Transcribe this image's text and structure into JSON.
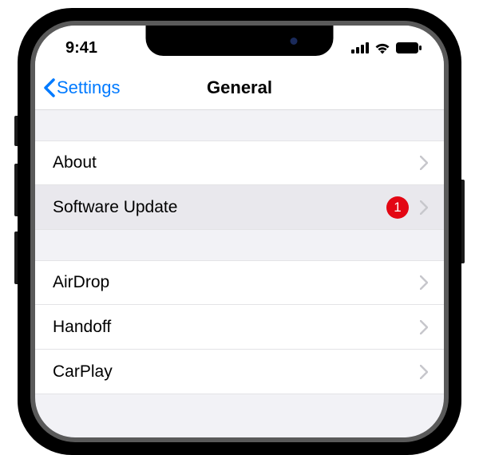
{
  "statusBar": {
    "time": "9:41"
  },
  "nav": {
    "backLabel": "Settings",
    "title": "General"
  },
  "groups": [
    {
      "rows": [
        {
          "label": "About",
          "badge": null,
          "highlighted": false
        },
        {
          "label": "Software Update",
          "badge": "1",
          "highlighted": true
        }
      ]
    },
    {
      "rows": [
        {
          "label": "AirDrop",
          "badge": null,
          "highlighted": false
        },
        {
          "label": "Handoff",
          "badge": null,
          "highlighted": false
        },
        {
          "label": "CarPlay",
          "badge": null,
          "highlighted": false
        }
      ]
    }
  ]
}
